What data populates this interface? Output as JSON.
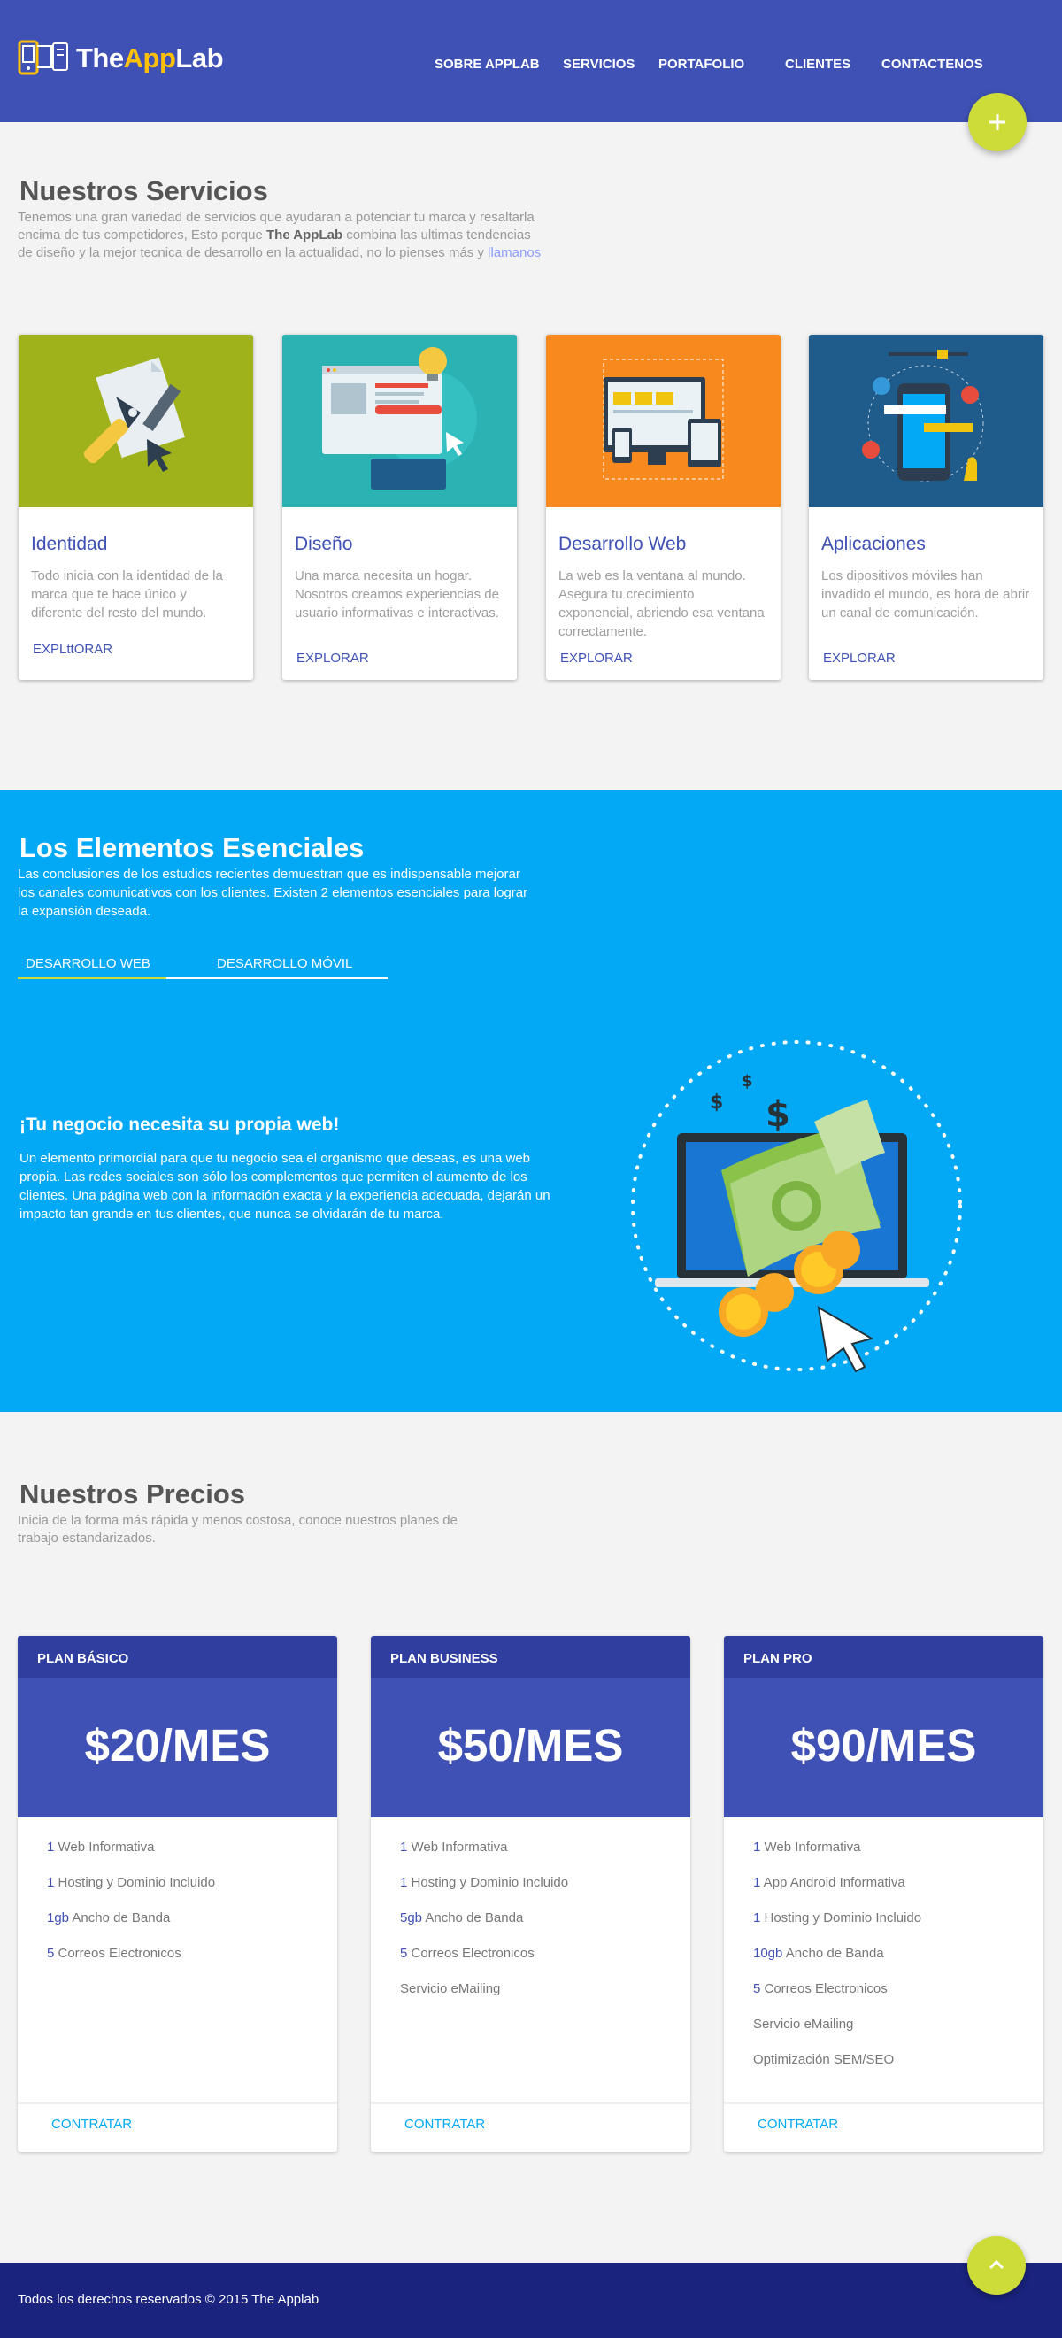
{
  "brand": {
    "name_part1": "The",
    "name_part2": "AppLab"
  },
  "nav": [
    {
      "label": "SOBRE APPLAB"
    },
    {
      "label": "SERVICIOS"
    },
    {
      "label": "PORTAFOLIO"
    },
    {
      "label": "CLIENTES"
    },
    {
      "label": "CONTACTENOS"
    }
  ],
  "fab_icon": "plus-icon",
  "services": {
    "title": "Nuestros Servicios",
    "desc_prefix": "Tenemos una gran variedad de servicios que ayudaran a potenciar tu marca y resaltarla encima de tus competidores, Esto porque ",
    "desc_bold": "The AppLab",
    "desc_middle": " combina las ultimas tendencias de diseño y la mejor tecnica de desarrollo en la actualidad, no lo pienses más y ",
    "desc_link": "llamanos",
    "cards": [
      {
        "title": "Identidad",
        "text": "Todo inicia con la identidad de la marca que te hace único y diferente del resto del mundo.",
        "link": "EXPLttORAR",
        "color": "#9fb21b"
      },
      {
        "title": "Diseño",
        "text": "Una marca necesita un hogar. Nosotros creamos experiencias de usuario informativas e interactivas.",
        "link": "EXPLORAR",
        "color": "#2bb3b4"
      },
      {
        "title": "Desarrollo Web",
        "text": "La web es la ventana al mundo. Asegura tu crecimiento exponencial, abriendo esa ventana correctamente.",
        "link": "EXPLORAR",
        "color": "#f7891f"
      },
      {
        "title": "Aplicaciones",
        "text": "Los dipositivos móviles han invadido el mundo, es hora de abrir un canal de comunicación.",
        "link": "EXPLORAR",
        "color": "#1f5c8c"
      }
    ]
  },
  "essentials": {
    "title": "Los Elementos Esenciales",
    "desc": "Las conclusiones de los estudios recientes demuestran que es indispensable mejorar los canales comunicativos con los clientes. Existen 2 elementos esenciales para lograr la expansión deseada.",
    "tabs": [
      {
        "label": "DESARROLLO WEB",
        "active": true
      },
      {
        "label": "DESARROLLO MÓVIL",
        "active": false
      }
    ],
    "heading": "¡Tu negocio necesita su propia web!",
    "paragraph": "Un elemento primordial para que tu negocio sea el organismo que deseas, es una web propia. Las redes sociales son sólo los complementos que permiten el aumento de los clientes. Una página web con la información exacta y la experiencia adecuada, dejarán un impacto tan grande en tus clientes, que nunca se olvidarán de tu marca.",
    "dollar_symbol": "$"
  },
  "pricing": {
    "title": "Nuestros Precios",
    "desc": "Inicia de la forma más rápida y menos costosa, conoce nuestros planes de trabajo estandarizados.",
    "plans": [
      {
        "name": "PLAN BÁSICO",
        "price": "$20/MES",
        "features": [
          {
            "num": "1",
            "text": " Web Informativa"
          },
          {
            "num": "1",
            "text": " Hosting y Dominio Incluido"
          },
          {
            "num": "1gb",
            "text": " Ancho de Banda"
          },
          {
            "num": "5",
            "text": " Correos Electronicos"
          }
        ],
        "cta": "CONTRATAR"
      },
      {
        "name": "PLAN BUSINESS",
        "price": "$50/MES",
        "features": [
          {
            "num": "1",
            "text": " Web Informativa"
          },
          {
            "num": "1",
            "text": " Hosting y Dominio Incluido"
          },
          {
            "num": "5gb",
            "text": " Ancho de Banda"
          },
          {
            "num": "5",
            "text": " Correos Electronicos"
          },
          {
            "num": "",
            "text": "Servicio eMailing"
          }
        ],
        "cta": "CONTRATAR"
      },
      {
        "name": "PLAN PRO",
        "price": "$90/MES",
        "features": [
          {
            "num": "1",
            "text": " Web Informativa"
          },
          {
            "num": "1",
            "text": " App Android Informativa"
          },
          {
            "num": "1",
            "text": " Hosting y Dominio Incluido"
          },
          {
            "num": "10gb",
            "text": " Ancho de Banda"
          },
          {
            "num": "5",
            "text": " Correos Electronicos"
          },
          {
            "num": "",
            "text": "Servicio eMailing"
          },
          {
            "num": "",
            "text": "Optimización SEM/SEO"
          }
        ],
        "cta": "CONTRATAR"
      }
    ]
  },
  "footer": {
    "text": "Todos los derechos reservados © 2015 The Applab",
    "fab_icon": "chevron-up-icon"
  }
}
